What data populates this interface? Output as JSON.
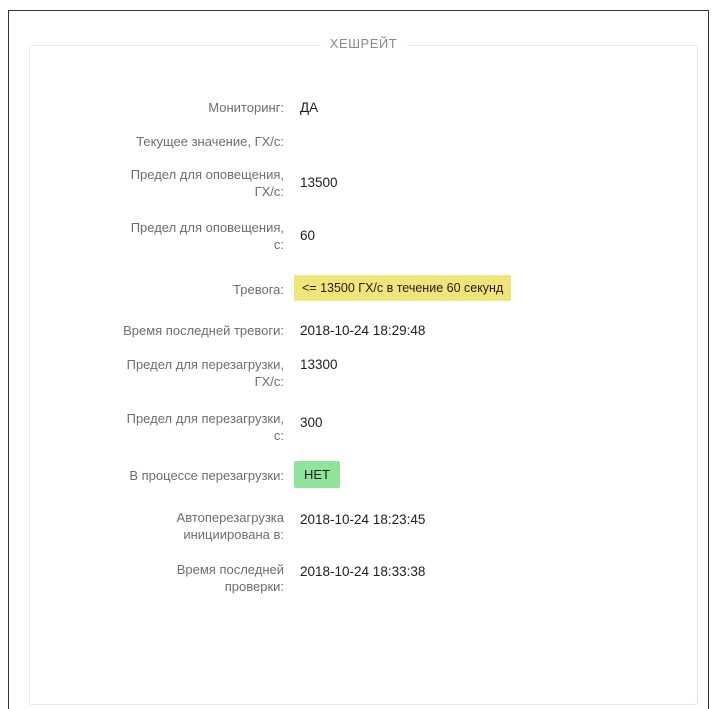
{
  "panel": {
    "title": "ХЕШРЕЙТ"
  },
  "fields": {
    "monitoring": {
      "label": "Мониторинг:",
      "value": "ДА"
    },
    "current_value": {
      "label": "Текущее значение, ГХ/с:",
      "value": ""
    },
    "alert_limit_ghs": {
      "label_line1": "Предел для оповещения,",
      "label_line2": "ГХ/с:",
      "value": "13500"
    },
    "alert_limit_s": {
      "label_line1": "Предел для оповещения,",
      "label_line2": "с:",
      "value": "60"
    },
    "alarm": {
      "label": "Тревога:",
      "value": "<= 13500 ГХ/с в течение 60 секунд"
    },
    "last_alarm_time": {
      "label": "Время последней тревоги:",
      "value": "2018-10-24 18:29:48"
    },
    "reboot_limit_ghs": {
      "label_line1": "Предел для перезагрузки,",
      "label_line2": "ГХ/с:",
      "value": "13300"
    },
    "reboot_limit_s": {
      "label_line1": "Предел для перезагрузки,",
      "label_line2": "с:",
      "value": "300"
    },
    "rebooting": {
      "label": "В процессе перезагрузки:",
      "value": "НЕТ"
    },
    "autoreboot_initiated": {
      "label_line1": "Автоперезагрузка",
      "label_line2": "инициирована в:",
      "value": "2018-10-24 18:23:45"
    },
    "last_check_time": {
      "label_line1": "Время последней",
      "label_line2": "проверки:",
      "value": "2018-10-24 18:33:38"
    }
  },
  "colors": {
    "alarm_badge": "#efe57a",
    "status_badge": "#8fe39a"
  }
}
